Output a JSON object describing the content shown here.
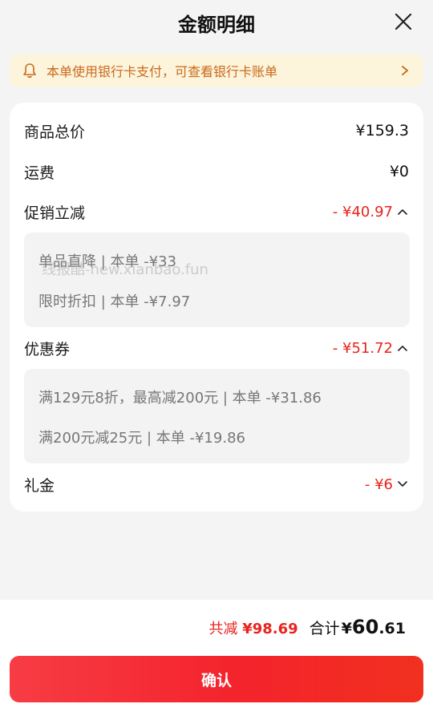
{
  "header": {
    "title": "金额明细"
  },
  "notice": {
    "text": "本单使用银行卡支付，可查看银行卡账单"
  },
  "rows": {
    "goods_total": {
      "label": "商品总价",
      "value": "¥159.3"
    },
    "shipping": {
      "label": "运费",
      "value": "¥0"
    },
    "promo": {
      "label": "促销立减",
      "value": "- ¥40.97",
      "items": [
        "单品直降 | 本单 -¥33",
        "限时折扣 | 本单 -¥7.97"
      ]
    },
    "coupon": {
      "label": "优惠券",
      "value": "- ¥51.72",
      "items": [
        "满129元8折，最高减200元 | 本单 -¥31.86",
        "满200元减25元 | 本单 -¥19.86"
      ]
    },
    "gift": {
      "label": "礼金",
      "value": "- ¥6"
    }
  },
  "watermark": "线报酷-new.xianbao.fun",
  "summary": {
    "saved_label": "共减",
    "saved_amount": "¥98.69",
    "total_label": "合计",
    "total_currency": "¥",
    "total_integer": "60",
    "total_decimal": ".61"
  },
  "confirm_label": "确认",
  "colors": {
    "accent_red": "#e8231d",
    "notice_bg": "#fdf4dc",
    "notice_text": "#c96a1c"
  }
}
